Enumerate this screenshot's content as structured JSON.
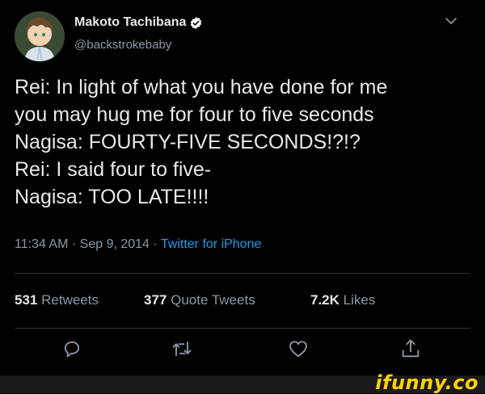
{
  "tweet": {
    "user": {
      "display_name": "Makoto Tachibana",
      "handle": "@backstrokebaby",
      "verified": true
    },
    "text_lines": [
      "Rei: In light of what you have done for me",
      "you may hug me for four to five seconds",
      "Nagisa: FOURTY-FIVE SECONDS!?!?",
      "Rei: I said four to five-",
      "Nagisa: TOO LATE!!!!"
    ],
    "meta": {
      "time": "11:34 AM",
      "separator": "·",
      "date": "Sep 9, 2014",
      "source": "Twitter for iPhone"
    },
    "stats": {
      "retweets_count": "531",
      "retweets_label": "Retweets",
      "quote_count": "377",
      "quote_label": "Quote Tweets",
      "likes_count": "7.2K",
      "likes_label": "Likes"
    },
    "actions": [
      "reply-icon",
      "retweet-icon",
      "like-icon",
      "share-icon"
    ]
  },
  "footer": {
    "brand": "ifunny.co"
  },
  "colors": {
    "background": "#000000",
    "text": "#e7e9ea",
    "muted": "#8b98a5",
    "link": "#1d9bf0",
    "divider": "#2f3336",
    "brand": "#ffd200"
  }
}
